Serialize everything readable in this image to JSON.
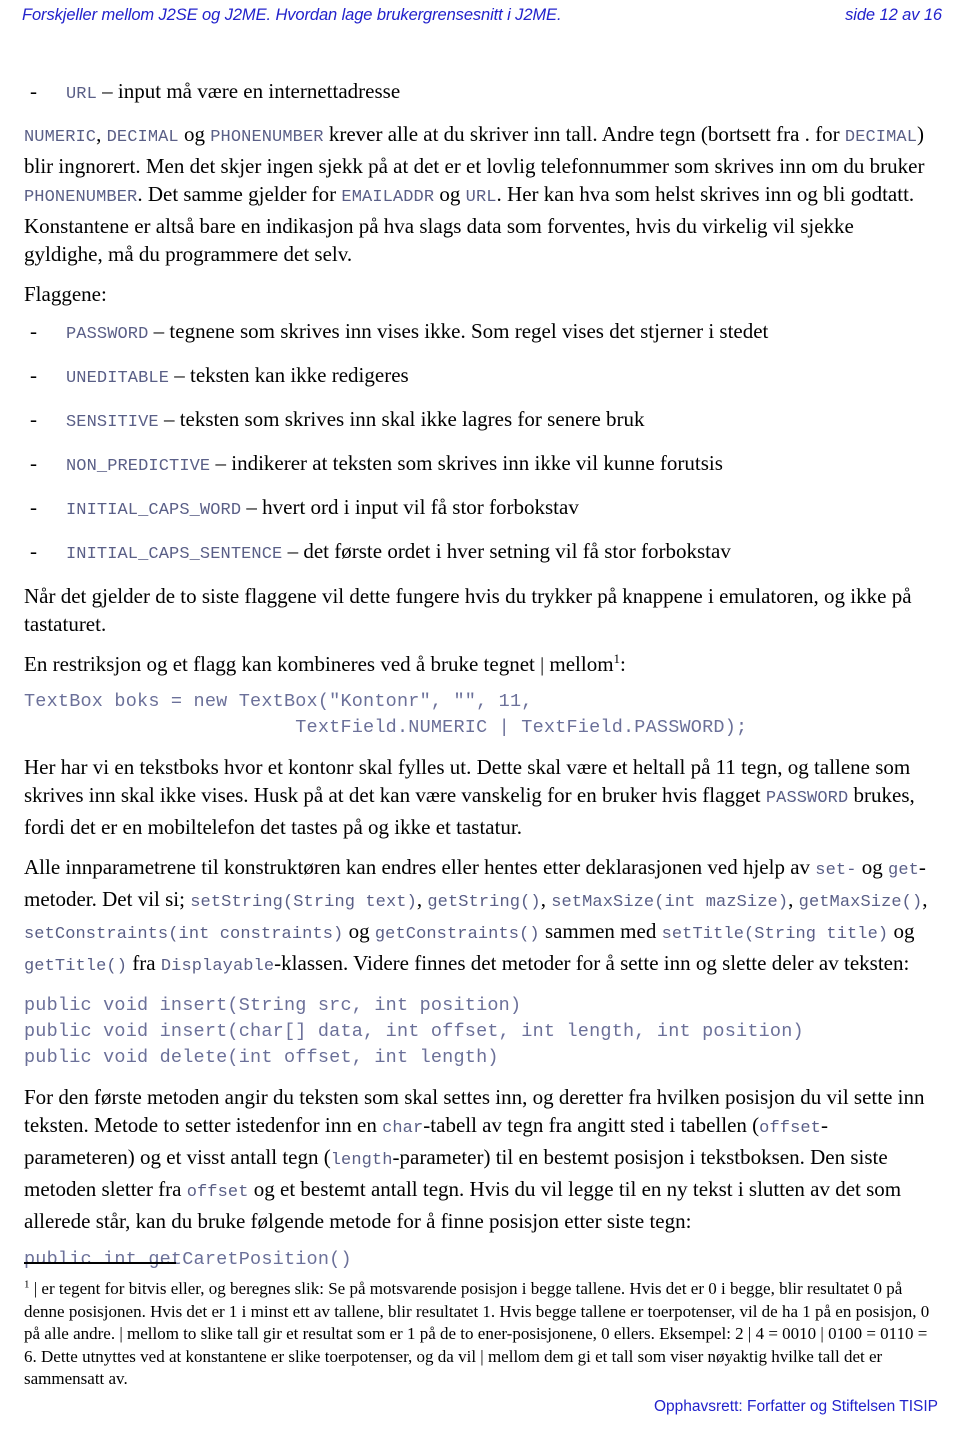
{
  "header": {
    "title": "Forskjeller mellom J2SE og J2ME. Hvordan lage brukergrensesnitt i J2ME.",
    "page_indicator": "side 12 av 16"
  },
  "body": {
    "url_bullet": {
      "dash": "-",
      "code": "URL",
      "desc": "– input må være en internettadresse"
    },
    "para_numeric": {
      "c1": "NUMERIC",
      "t1": ", ",
      "c2": "DECIMAL",
      "t2": " og ",
      "c3": "PHONENUMBER",
      "t3": " krever alle at du skriver inn tall. Andre tegn (bortsett fra . for ",
      "c4": "DECIMAL",
      "t4": ") blir ingnorert. Men det skjer ingen sjekk på at det er et lovlig telefonnummer som skrives inn om du bruker ",
      "c5": "PHONENUMBER",
      "t5": ". Det samme gjelder for ",
      "c6": "EMAILADDR",
      "t6": " og ",
      "c7": "URL",
      "t7": ". Her kan hva som helst skrives inn og bli godtatt. Konstantene er altså bare en indikasjon på hva slags data som forventes, hvis du virkelig vil sjekke gyldighe, må du programmere det selv."
    },
    "flaggene_label": "Flaggene:",
    "flags": [
      {
        "dash": "-",
        "name": "PASSWORD",
        "desc": "– tegnene som skrives inn vises ikke. Som regel vises det stjerner i stedet"
      },
      {
        "dash": "-",
        "name": "UNEDITABLE",
        "desc": "– teksten kan ikke redigeres"
      },
      {
        "dash": "-",
        "name": "SENSITIVE",
        "desc": "– teksten som skrives inn skal ikke lagres for senere bruk"
      },
      {
        "dash": "-",
        "name": "NON_PREDICTIVE",
        "desc": "– indikerer at teksten som skrives inn ikke vil kunne forutsis"
      },
      {
        "dash": "-",
        "name": "INITIAL_CAPS_WORD",
        "desc": "– hvert ord i input vil få stor forbokstav"
      },
      {
        "dash": "-",
        "name": "INITIAL_CAPS_SENTENCE",
        "desc": "– det første ordet i hver setning vil få stor forbokstav"
      }
    ],
    "para_naar": "Når det gjelder de to siste flaggene vil dette fungere hvis du trykker på knappene i emulatoren, og ikke på tastaturet.",
    "para_restriksjon": {
      "t1": "En restriksjon og et flagg kan kombineres ved å bruke tegnet ",
      "pipe": "|",
      "t2": " mellom",
      "fnref": "1",
      "t3": ":"
    },
    "codeblock_textbox": "TextBox boks = new TextBox(\"Kontonr\", \"\", 11,\n                        TextField.NUMERIC | TextField.PASSWORD);",
    "para_tekstboks": {
      "t1": "Her har vi en tekstboks hvor et kontonr skal fylles ut. Dette skal være et heltall på 11 tegn, og tallene som skrives inn skal ikke vises. Husk på at det kan være vanskelig for en bruker hvis flagget ",
      "c1": "PASSWORD",
      "t2": " brukes, fordi det er en mobiltelefon det tastes på og ikke et tastatur."
    },
    "para_parametre": {
      "t1": "Alle innparametrene til konstruktøren kan endres eller hentes etter deklarasjonen ved hjelp av ",
      "c1": "set-",
      "t2": " og ",
      "c2": "get",
      "t3": "-metoder. Det vil si; ",
      "c3": "setString(String text)",
      "t4": ", ",
      "c4": "getString()",
      "t5": ", ",
      "c5": "setMaxSize(int mazSize)",
      "t6": ", ",
      "c6": "getMaxSize()",
      "t7": ", ",
      "c7": "setConstraints(int constraints)",
      "t8": " og ",
      "c8": "getConstraints()",
      "t9": " sammen med ",
      "c9": "setTitle(String title)",
      "t10": " og ",
      "c10": "getTitle()",
      "t11": " fra ",
      "c11": "Displayable",
      "t12": "-klassen. Videre finnes det metoder for å sette inn og slette deler av teksten:"
    },
    "codeblock_insert": "public void insert(String src, int position)\npublic void insert(char[] data, int offset, int length, int position)\npublic void delete(int offset, int length)",
    "para_metoder": {
      "t1": "For den første metoden angir du teksten som skal settes inn, og deretter fra hvilken posisjon du vil sette inn teksten. Metode to setter istedenfor inn en ",
      "c1": "char",
      "t2": "-tabell av tegn fra angitt sted i tabellen (",
      "c2": "offset",
      "t3": "-parameteren) og et visst antall tegn (",
      "c3": "length",
      "t4": "-parameter) til en bestemt posisjon i tekstboksen. Den siste metoden sletter fra ",
      "c4": "offset",
      "t5": " og et bestemt antall tegn. Hvis du vil legge til en ny tekst i slutten av det som allerede står, kan du bruke følgende metode for å finne posisjon etter siste tegn:"
    },
    "codeblock_caret": "public int getCaretPosition()"
  },
  "footnote": {
    "marker": "1",
    "text": " | er tegent for bitvis eller, og beregnes slik: Se på motsvarende posisjon i begge tallene. Hvis det er 0 i begge, blir resultatet 0 på denne posisjonen. Hvis det er 1 i minst ett av tallene, blir resultatet 1. Hvis begge tallene er toerpotenser, vil de ha 1 på en posisjon, 0 på alle andre. | mellom to slike tall gir et resultat som er 1 på de to ener-posisjonene, 0 ellers. Eksempel: 2 | 4 = 0010 | 0100 = 0110 = 6. Dette utnyttes ved at konstantene er slike toerpotenser, og da vil | mellom dem gi et tall som viser nøyaktig hvilke tall det er sammensatt av."
  },
  "footer": {
    "copyright": "Opphavsrett:  Forfatter og Stiftelsen TISIP"
  },
  "colors": {
    "header_blue": "#2222cc",
    "code_slate": "#5a5f87",
    "codeblock_slate": "#6b7099",
    "body_black": "#000000"
  }
}
